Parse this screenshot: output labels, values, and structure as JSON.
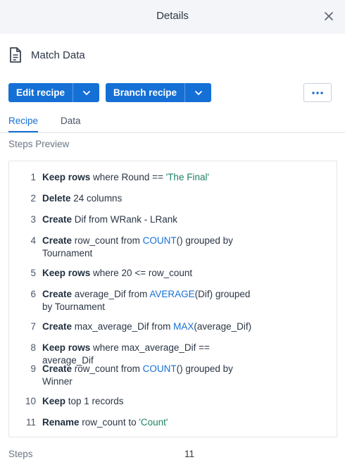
{
  "header": {
    "title": "Details"
  },
  "dataset": {
    "name": "Match Data",
    "icon": "document-icon"
  },
  "actions": {
    "edit_recipe": "Edit recipe",
    "branch_recipe": "Branch recipe",
    "more": "more-options-icon"
  },
  "tabs": [
    {
      "label": "Recipe",
      "active": true
    },
    {
      "label": "Data",
      "active": false
    }
  ],
  "steps_preview_label": "Steps Preview",
  "steps": [
    {
      "n": "1",
      "parts": [
        {
          "t": "Keep rows",
          "s": "kw"
        },
        {
          "t": " where Round == "
        },
        {
          "t": "'The Final'",
          "s": "lit"
        }
      ]
    },
    {
      "n": "2",
      "parts": [
        {
          "t": "Delete",
          "s": "kw"
        },
        {
          "t": " 24 columns"
        }
      ]
    },
    {
      "n": "3",
      "parts": [
        {
          "t": "Create",
          "s": "kw"
        },
        {
          "t": " Dif from WRank - LRank"
        }
      ]
    },
    {
      "n": "4",
      "parts": [
        {
          "t": "Create",
          "s": "kw"
        },
        {
          "t": " row_count from "
        },
        {
          "t": "COUNT",
          "s": "fn"
        },
        {
          "t": "() grouped by Tournament"
        }
      ]
    },
    {
      "n": "5",
      "parts": [
        {
          "t": "Keep rows",
          "s": "kw"
        },
        {
          "t": " where 20 <= row_count"
        }
      ]
    },
    {
      "n": "6",
      "parts": [
        {
          "t": "Create",
          "s": "kw"
        },
        {
          "t": " average_Dif from "
        },
        {
          "t": "AVERAGE",
          "s": "fn"
        },
        {
          "t": "(Dif) grouped by Tournament"
        }
      ]
    },
    {
      "n": "7",
      "parts": [
        {
          "t": "Create",
          "s": "kw"
        },
        {
          "t": " max_average_Dif from "
        },
        {
          "t": "MAX",
          "s": "fn"
        },
        {
          "t": "(average_Dif)"
        }
      ]
    },
    {
      "n": "8",
      "parts": [
        {
          "t": "Keep rows",
          "s": "kw"
        },
        {
          "t": " where max_average_Dif == average_Dif"
        }
      ]
    },
    {
      "n": "9",
      "parts": [
        {
          "t": "Create",
          "s": "kw"
        },
        {
          "t": " row_count from "
        },
        {
          "t": "COUNT",
          "s": "fn"
        },
        {
          "t": "() grouped by Winner"
        }
      ]
    },
    {
      "n": "10",
      "parts": [
        {
          "t": "Keep",
          "s": "kw"
        },
        {
          "t": " top 1 records"
        }
      ]
    },
    {
      "n": "11",
      "parts": [
        {
          "t": "Rename",
          "s": "kw"
        },
        {
          "t": " row_count to "
        },
        {
          "t": "'Count'",
          "s": "lit"
        }
      ]
    }
  ],
  "footer": {
    "label": "Steps",
    "value": "11"
  },
  "colors": {
    "accent": "#1570d6",
    "literal": "#1d8266",
    "header_bg": "#f3f5f9"
  }
}
